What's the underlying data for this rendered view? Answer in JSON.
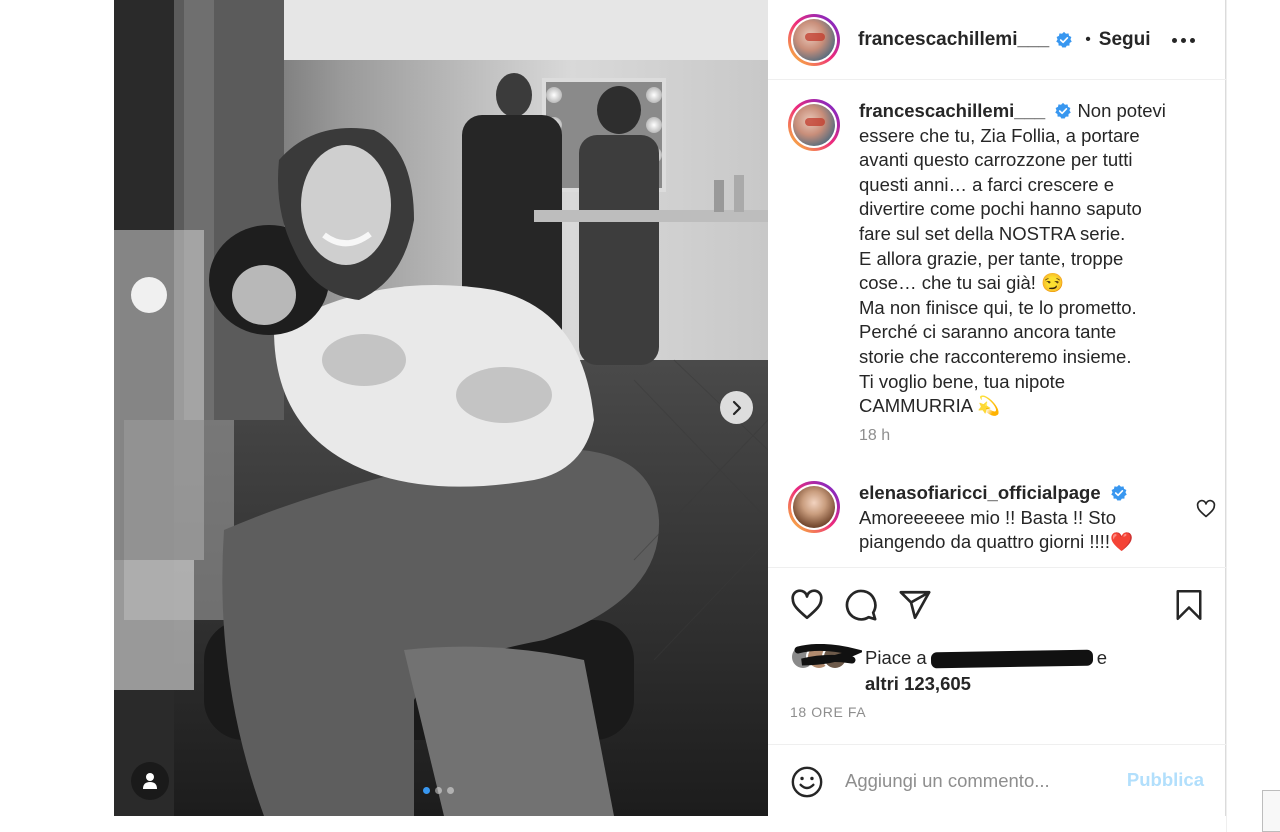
{
  "post": {
    "author": {
      "username": "francescachillemi___",
      "verified": true,
      "follow_label": "Segui",
      "separator": "•"
    },
    "photo": {
      "description_icon": "user-tag-icon",
      "carousel_count": 3,
      "carousel_active": 1
    },
    "caption": {
      "username": "francescachillemi___",
      "lines": [
        "Non potevi",
        "essere che tu, Zia Follia, a portare",
        "avanti questo carrozzone per tutti",
        "questi anni… a farci crescere e",
        "divertire come pochi hanno saputo",
        "fare sul set della NOSTRA serie.",
        "E allora grazie, per tante, troppe",
        "cose… che tu sai già! 😏",
        "Ma non finisce qui, te lo prometto.",
        "Perché ci saranno ancora tante",
        "storie che racconteremo insieme.",
        "Ti voglio bene, tua nipote",
        "CAMMURRIA 💫"
      ],
      "time": "18 h"
    },
    "comments": [
      {
        "username": "elenasofiaricci_officialpage",
        "verified": true,
        "lines": [
          "Amoreeeeee mio !! Basta !! Sto",
          "piangendo da quattro giorni !!!!❤️"
        ]
      }
    ],
    "likes": {
      "prefix": "Piace a",
      "suffix": "e",
      "others": "altri 123,605"
    },
    "timestamp": "18 ORE FA",
    "add_comment": {
      "placeholder": "Aggiungi un commento...",
      "publish_label": "Pubblica"
    },
    "colors": {
      "verified": "#3897f0",
      "publish_disabled": "#b2dffc",
      "muted": "#8e8e8e",
      "text": "#262626"
    }
  }
}
